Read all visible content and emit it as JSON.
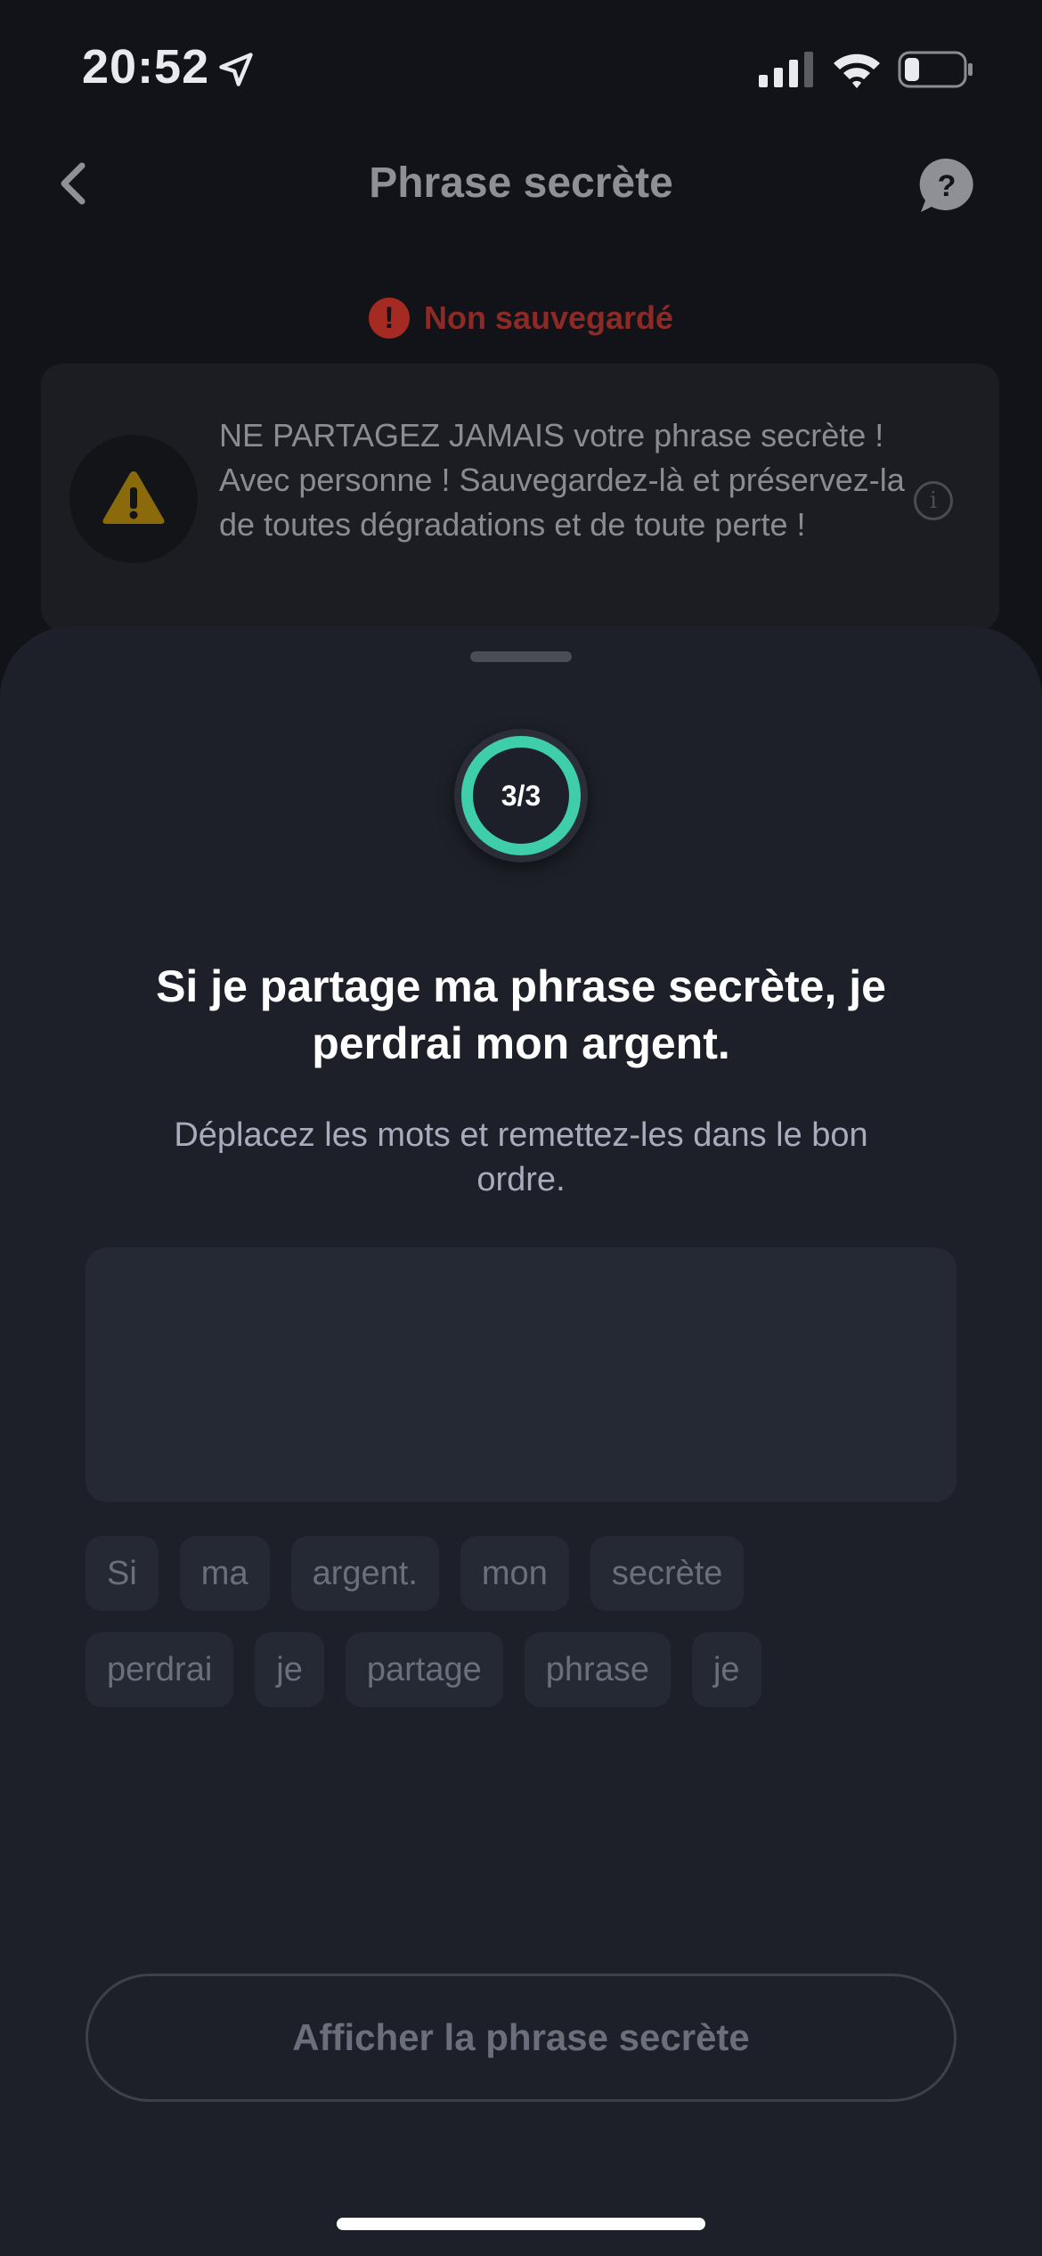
{
  "status_bar": {
    "time": "20:52"
  },
  "header": {
    "title": "Phrase secrète",
    "help_label": "?"
  },
  "save_status": {
    "text": "Non sauvegardé",
    "color": "#8e2a25"
  },
  "warning": {
    "text": "NE PARTAGEZ JAMAIS votre phrase secrète ! Avec personne ! Sauvegardez-là et préservez-la de toutes dégradations et de toute perte !",
    "info_label": "i"
  },
  "sheet": {
    "progress_label": "3/3",
    "progress_fraction": 1.0,
    "title": "Si je partage ma phrase secrète, je perdrai mon argent.",
    "subtitle": "Déplacez les mots et remettez-les dans le bon ordre.",
    "word_rows": [
      [
        "Si",
        "ma",
        "argent.",
        "mon",
        "secrète"
      ],
      [
        "perdrai",
        "je",
        "partage",
        "phrase",
        "je"
      ]
    ],
    "show_button_label": "Afficher la phrase secrète"
  },
  "colors": {
    "accent": "#3ecfaa",
    "background": "#121318",
    "sheet": "#1d2028"
  }
}
